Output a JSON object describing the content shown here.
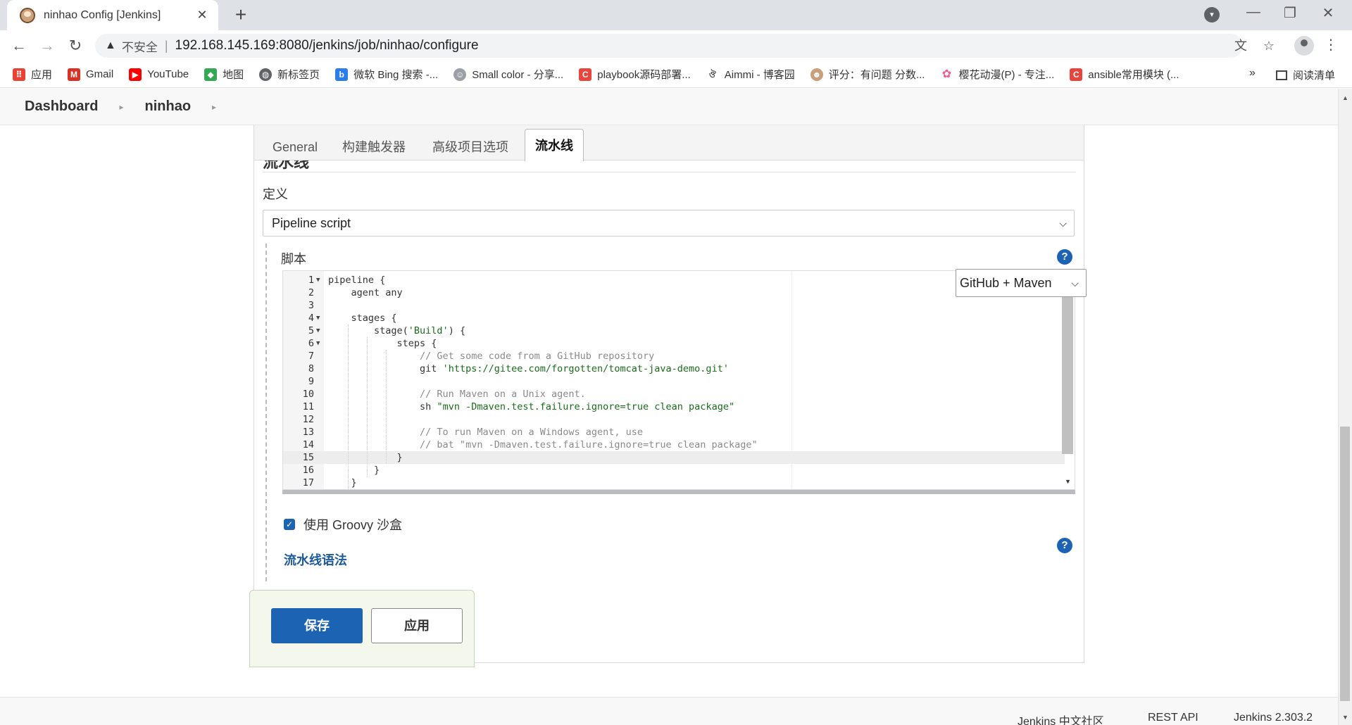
{
  "browser": {
    "tab_title": "ninhao Config [Jenkins]",
    "insecure_label": "不安全",
    "url": "192.168.145.169:8080/jenkins/job/ninhao/configure",
    "bookmarks": [
      {
        "label": "应用",
        "color": "#e94235"
      },
      {
        "label": "Gmail",
        "color": "#d93025"
      },
      {
        "label": "YouTube",
        "color": "#ff0000"
      },
      {
        "label": "地图",
        "color": "#34a853"
      },
      {
        "label": "新标签页",
        "color": "#5f6368"
      },
      {
        "label": "微软 Bing 搜索 -...",
        "color": "#2b7de9"
      },
      {
        "label": "Small color - 分享...",
        "color": "#9aa0a6"
      },
      {
        "label": "playbook源码部署...",
        "color": "#e8453c"
      },
      {
        "label": "Aimmi - 博客园",
        "color": "#444444"
      },
      {
        "label": "评分：有问题 分数...",
        "color": "#c89f7a"
      },
      {
        "label": "樱花动漫(P) - 专注...",
        "color": "#ee5d8a"
      },
      {
        "label": "ansible常用模块 (...",
        "color": "#e8453c"
      }
    ],
    "bookmarks_more": "»",
    "reading_list": "阅读清单"
  },
  "breadcrumb": [
    "Dashboard",
    "ninhao"
  ],
  "tabs": [
    "General",
    "构建触发器",
    "高级项目选项",
    "流水线"
  ],
  "section": {
    "title": "流水线",
    "definition_label": "定义",
    "definition_value": "Pipeline script",
    "script_label": "脚本",
    "template_value": "GitHub + Maven",
    "sandbox_label": "使用 Groovy 沙盒",
    "syntax_link": "流水线语法"
  },
  "code_lines": [
    "pipeline {",
    "    agent any",
    "",
    "    stages {",
    "        stage('Build') {",
    "            steps {",
    "                // Get some code from a GitHub repository",
    "                git 'https://gitee.com/forgotten/tomcat-java-demo.git'",
    "",
    "                // Run Maven on a Unix agent.",
    "                sh \"mvn -Dmaven.test.failure.ignore=true clean package\"",
    "",
    "                // To run Maven on a Windows agent, use",
    "                // bat \"mvn -Dmaven.test.failure.ignore=true clean package\"",
    "            }",
    "        }",
    "    }"
  ],
  "buttons": {
    "save": "保存",
    "apply": "应用"
  },
  "footer": {
    "community": "Jenkins 中文社区",
    "rest_api": "REST API",
    "version": "Jenkins 2.303.2"
  },
  "colors": {
    "accent": "#1d63b4",
    "link": "#1d5a9a"
  }
}
